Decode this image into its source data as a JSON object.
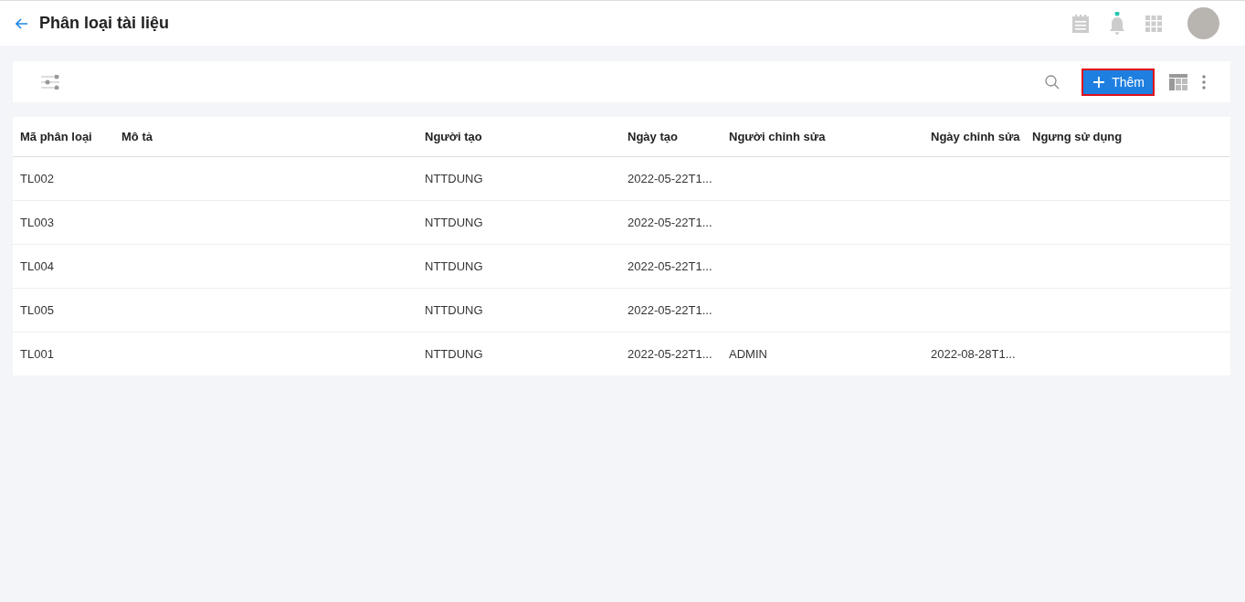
{
  "header": {
    "title": "Phân loại tài liệu",
    "notification_dot": true
  },
  "toolbar": {
    "add_button": "Thêm"
  },
  "table": {
    "columns": [
      "Mã phân loại",
      "Mô tả",
      "Người tạo",
      "Ngày tạo",
      "Người chỉnh sửa",
      "Ngày chỉnh sửa",
      "Ngưng sử dụng"
    ],
    "rows": [
      {
        "code": "TL002",
        "creator": "NTTDUNG",
        "created": "2022-05-22T1..."
      },
      {
        "code": "TL003",
        "creator": "NTTDUNG",
        "created": "2022-05-22T1..."
      },
      {
        "code": "TL004",
        "creator": "NTTDUNG",
        "created": "2022-05-22T1..."
      },
      {
        "code": "TL005",
        "creator": "NTTDUNG",
        "created": "2022-05-22T1..."
      },
      {
        "code": "TL001",
        "creator": "NTTDUNG",
        "created": "2022-05-22T1...",
        "editor": "ADMIN",
        "edited": "2022-08-28T1..."
      }
    ]
  }
}
